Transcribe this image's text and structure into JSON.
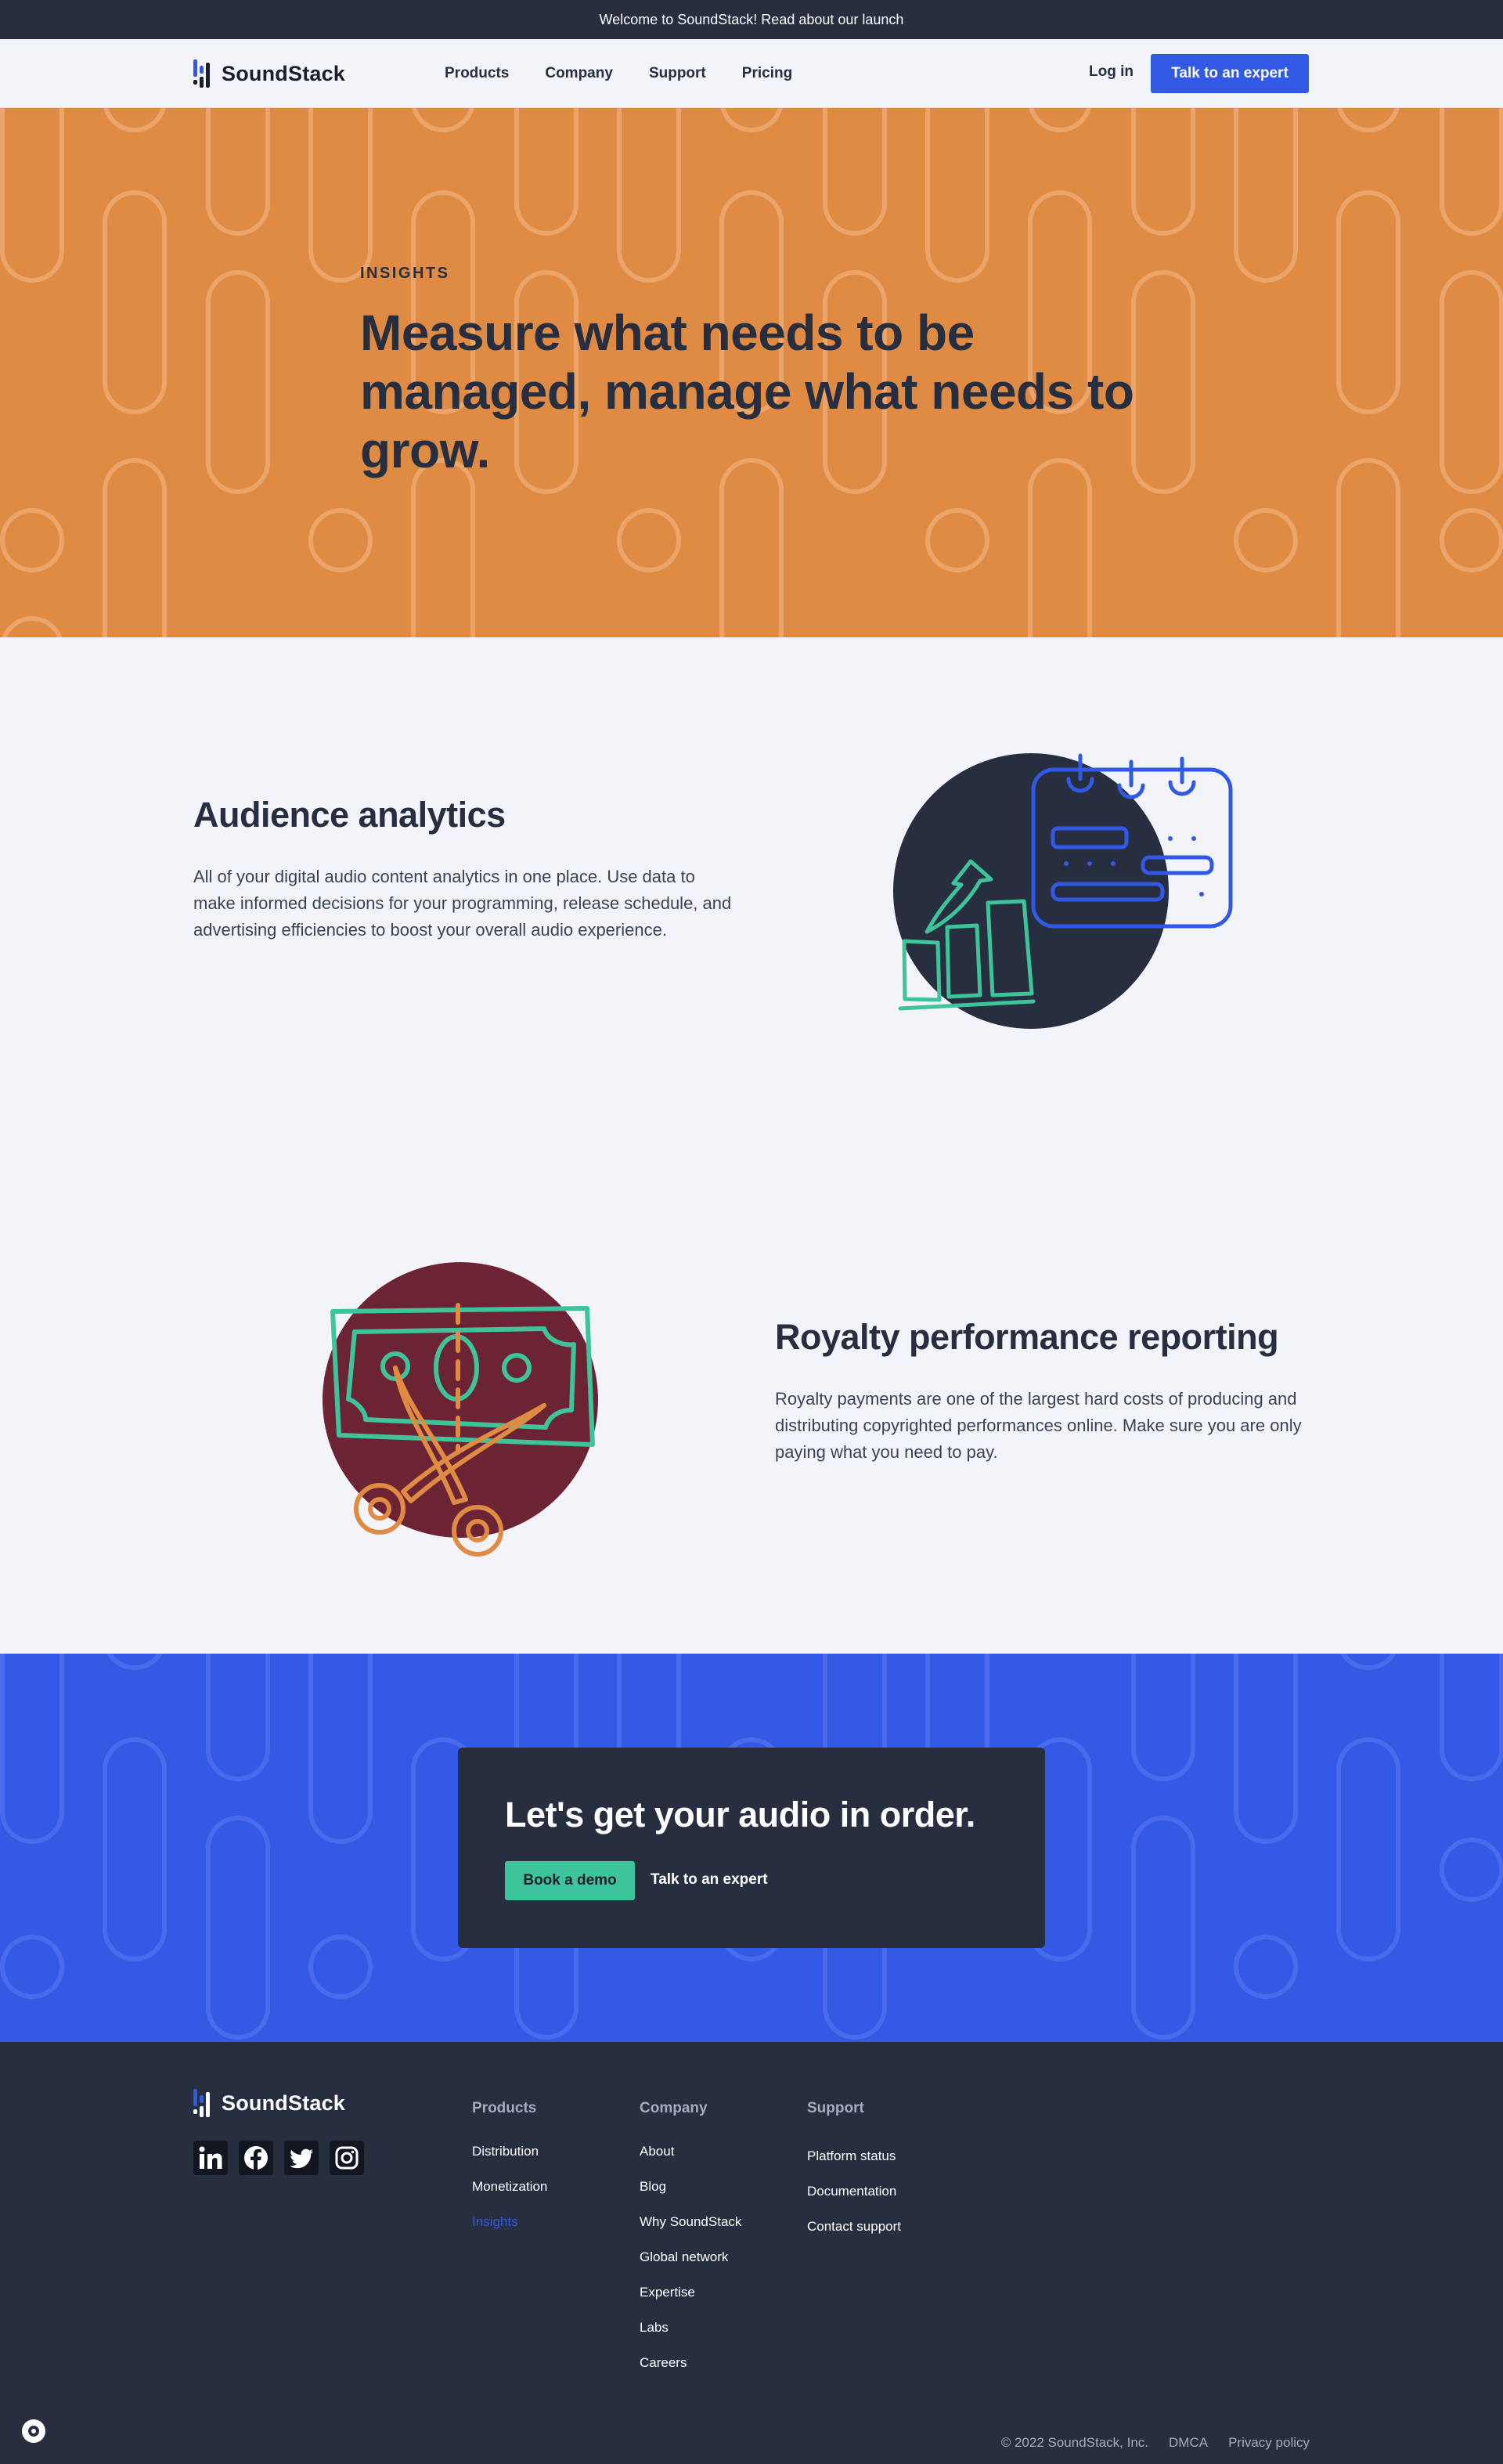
{
  "banner": {
    "text": "Welcome to SoundStack! Read about our launch"
  },
  "brand": {
    "name": "SoundStack",
    "accent": "#3159e4",
    "dark": "#262e40",
    "orange": "#df8b44",
    "green": "#3ec49a",
    "maroon": "#6c2434"
  },
  "nav": {
    "links": [
      "Products",
      "Company",
      "Support",
      "Pricing"
    ],
    "login": "Log in",
    "cta": "Talk to an expert"
  },
  "hero": {
    "eyebrow": "INSIGHTS",
    "title": "Measure what needs to be managed, manage what needs to grow."
  },
  "features": [
    {
      "title": "Audience analytics",
      "body": "All of your digital audio content analytics in one place. Use data to make informed decisions for your programming, release schedule, and advertising efficiencies to boost your overall audio experience.",
      "icon": "analytics-calendar-chart-illustration"
    },
    {
      "title": "Royalty performance reporting",
      "body": "Royalty payments are one of the largest hard costs of producing and distributing copyrighted performances online. Make sure you are only paying what you need to pay.",
      "icon": "scissors-cutting-money-illustration"
    }
  ],
  "cta": {
    "title": "Let's get your audio in order.",
    "primary": "Book a demo",
    "secondary": "Talk to an expert"
  },
  "footer": {
    "socials": [
      "linkedin-icon",
      "facebook-icon",
      "twitter-icon",
      "instagram-icon"
    ],
    "columns": [
      {
        "heading": "Products",
        "items": [
          "Distribution",
          "Monetization",
          "Insights"
        ]
      },
      {
        "heading": "Company",
        "items": [
          "About",
          "Blog",
          "Why SoundStack",
          "Global network",
          "Expertise",
          "Labs",
          "Careers"
        ]
      },
      {
        "heading": "Support",
        "items": [
          "Platform status",
          "Documentation",
          "Contact support"
        ]
      }
    ],
    "active_item": "Insights",
    "copyright": "© 2022 SoundStack, Inc.",
    "dmca": "DMCA",
    "privacy": "Privacy policy"
  }
}
